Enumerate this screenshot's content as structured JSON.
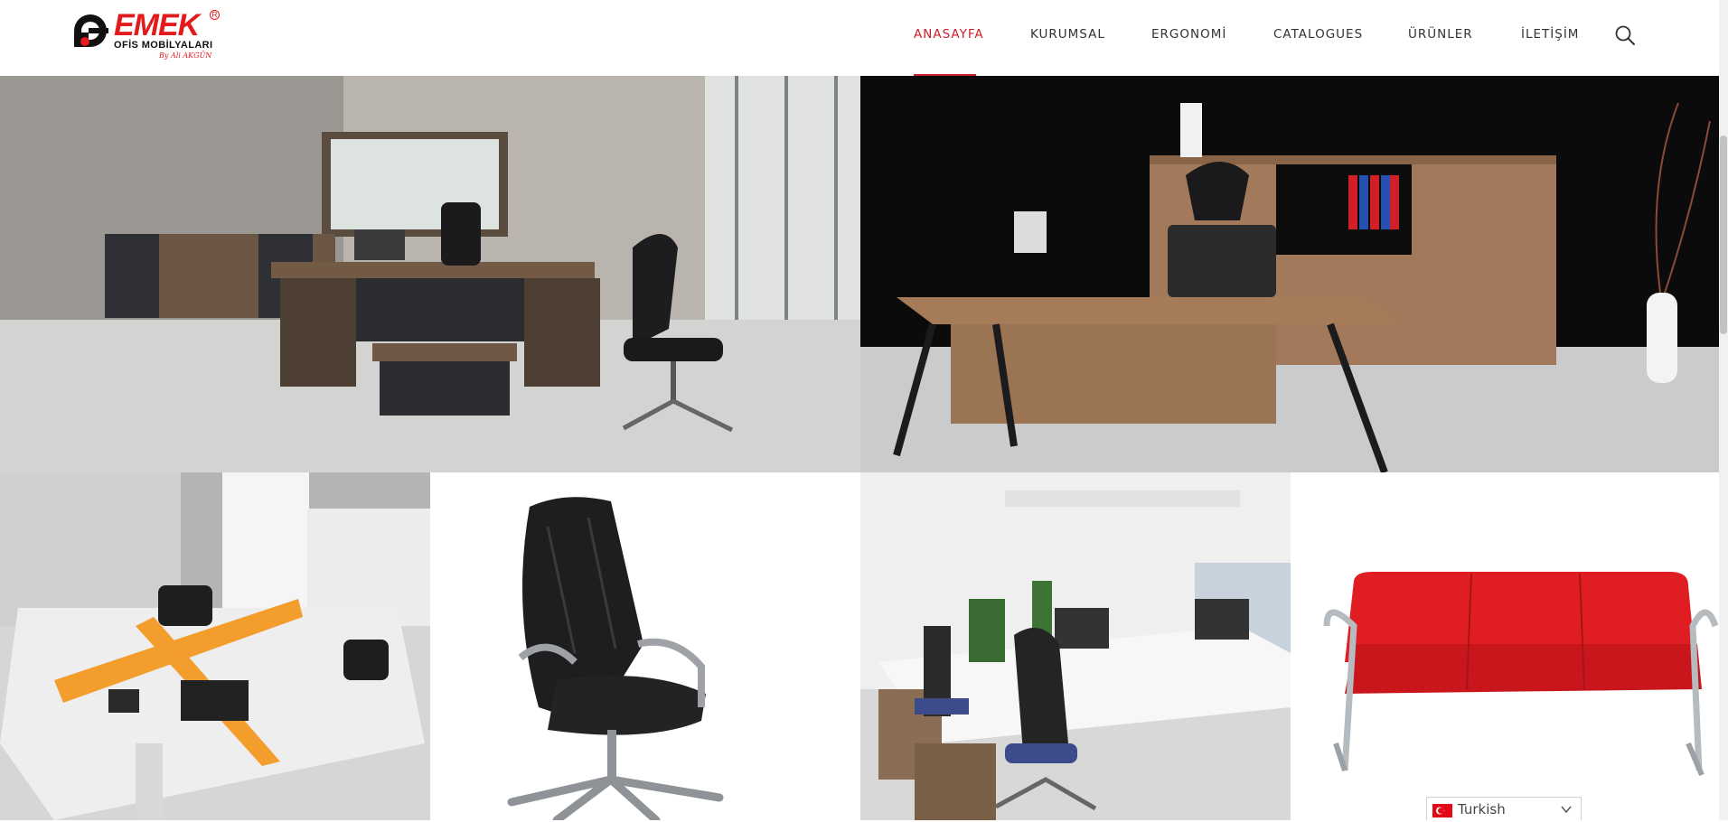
{
  "logo": {
    "word": "EMEK",
    "sub": "OFİS MOBİLYALARI",
    "signature": "By Ali AKGÜN",
    "reg": "R"
  },
  "nav": {
    "items": [
      {
        "label": "ANASAYFA",
        "active": true
      },
      {
        "label": "KURUMSAL"
      },
      {
        "label": "ERGONOMİ"
      },
      {
        "label": "CATALOGUES"
      },
      {
        "label": "ÜRÜNLER"
      },
      {
        "label": "İLETİŞİM"
      }
    ],
    "search_icon": "search-icon",
    "accent_color": "#c9202c"
  },
  "gallery": {
    "images": [
      {
        "name": "executive-office-concrete-photo",
        "icon": "office-desk-photo"
      },
      {
        "name": "executive-office-dark-photo",
        "icon": "office-desk-photo"
      },
      {
        "name": "workstation-orange-photo",
        "icon": "workstation-photo"
      },
      {
        "name": "leather-office-chair-photo",
        "icon": "chair-photo"
      },
      {
        "name": "open-office-desks-photo",
        "icon": "workstation-photo"
      },
      {
        "name": "red-sofa-photo",
        "icon": "sofa-photo"
      }
    ]
  },
  "language": {
    "selected": "Turkish",
    "flag_color": "#e30a17"
  }
}
